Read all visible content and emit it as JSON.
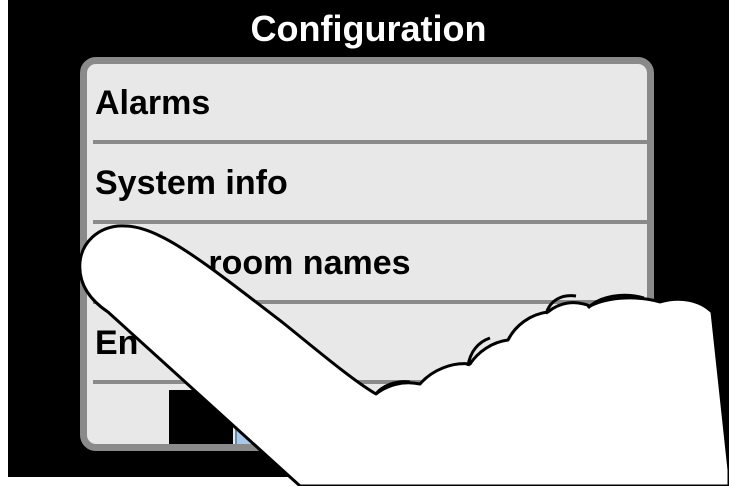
{
  "screen": {
    "title": "Configuration",
    "background_color": "#000000"
  },
  "menu": {
    "items": [
      {
        "label": "Alarms"
      },
      {
        "label": "System info"
      },
      {
        "label": "Define room names"
      },
      {
        "label": "En"
      }
    ],
    "background_color": "#e8e8e8",
    "border_color": "#8a8a8a"
  },
  "overlay": {
    "icon": "pointing-hand-icon"
  }
}
